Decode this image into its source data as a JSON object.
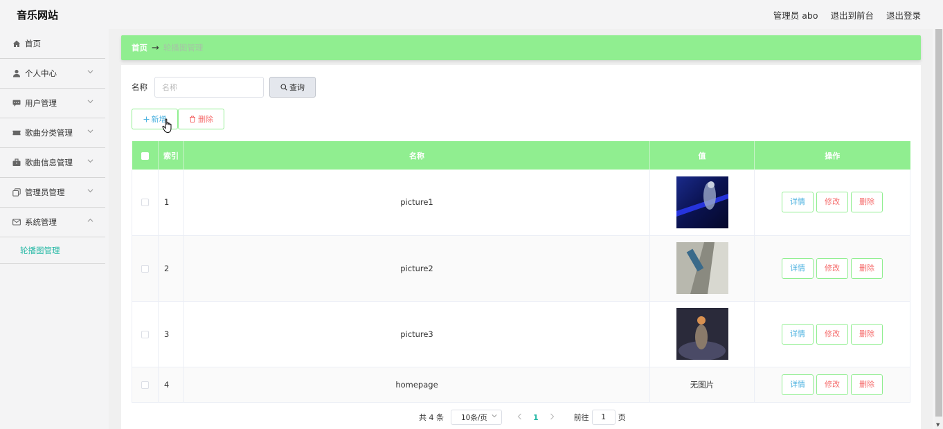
{
  "header": {
    "title": "音乐网站",
    "user_label": "管理员 abo",
    "back_label": "退出到前台",
    "logout_label": "退出登录"
  },
  "sidebar": {
    "items": [
      {
        "label": "首页",
        "icon": "home-icon"
      },
      {
        "label": "个人中心",
        "icon": "user-icon"
      },
      {
        "label": "用户管理",
        "icon": "chat-icon"
      },
      {
        "label": "歌曲分类管理",
        "icon": "ticket-icon"
      },
      {
        "label": "歌曲信息管理",
        "icon": "briefcase-icon"
      },
      {
        "label": "管理员管理",
        "icon": "copy-icon"
      },
      {
        "label": "系统管理",
        "icon": "mail-icon"
      }
    ],
    "sub_item": "轮播图管理"
  },
  "breadcrumb": {
    "home": "首页",
    "arrow": "→",
    "current": "轮播图管理"
  },
  "search": {
    "label": "名称",
    "placeholder": "名称",
    "query_label": "查询"
  },
  "actions": {
    "add_label": "新增",
    "delete_label": "删除"
  },
  "table": {
    "headers": [
      "索引",
      "名称",
      "值",
      "操作"
    ],
    "rows": [
      {
        "index": "1",
        "name": "picture1",
        "value": ""
      },
      {
        "index": "2",
        "name": "picture2",
        "value": ""
      },
      {
        "index": "3",
        "name": "picture3",
        "value": ""
      },
      {
        "index": "4",
        "name": "homepage",
        "value": "无图片"
      }
    ],
    "op_detail": "详情",
    "op_edit": "修改",
    "op_delete": "删除"
  },
  "pagination": {
    "total": "共 4 条",
    "page_size": "10条/页",
    "current_page": "1",
    "goto_label": "前往",
    "goto_value": "1",
    "page_suffix": "页"
  },
  "colors": {
    "accent_green": "#90ee90",
    "link_teal": "#23b7a4",
    "detail_blue": "#4fb3e0",
    "danger_red": "#f56c6c"
  }
}
